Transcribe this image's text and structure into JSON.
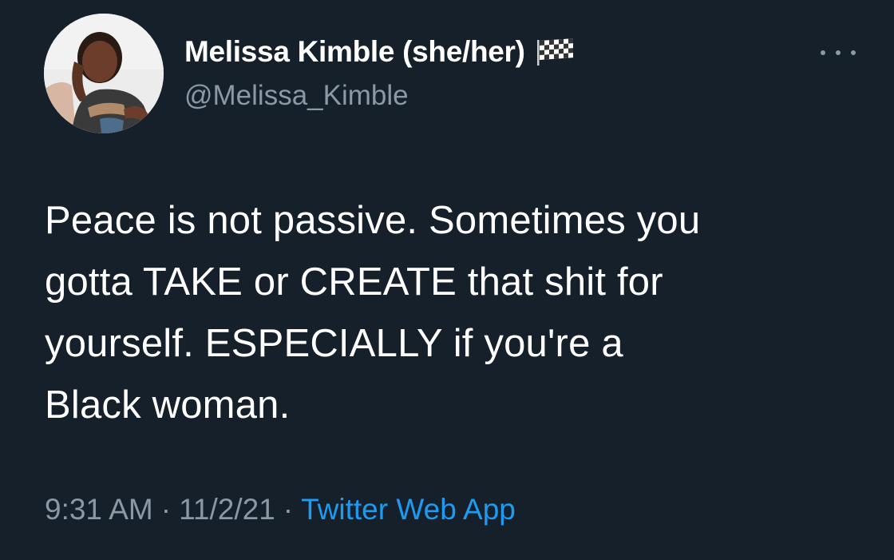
{
  "author": {
    "display_name": "Melissa Kimble (she/her)",
    "handle": "@Melissa_Kimble",
    "flag_icon": "checkered-flag-icon",
    "avatar": "profile-photo"
  },
  "more_icon": "more-options-icon",
  "tweet": {
    "lines": [
      "Peace is not passive. Sometimes you",
      "gotta TAKE or CREATE that shit for",
      "yourself. ESPECIALLY if you're a",
      "Black woman."
    ]
  },
  "meta": {
    "time": "9:31 AM",
    "separator": "·",
    "date": "11/2/21",
    "source": "Twitter Web App"
  },
  "colors": {
    "background": "#15202b",
    "text": "#ffffff",
    "secondary": "#8b98a5",
    "link": "#1d9bf0"
  }
}
